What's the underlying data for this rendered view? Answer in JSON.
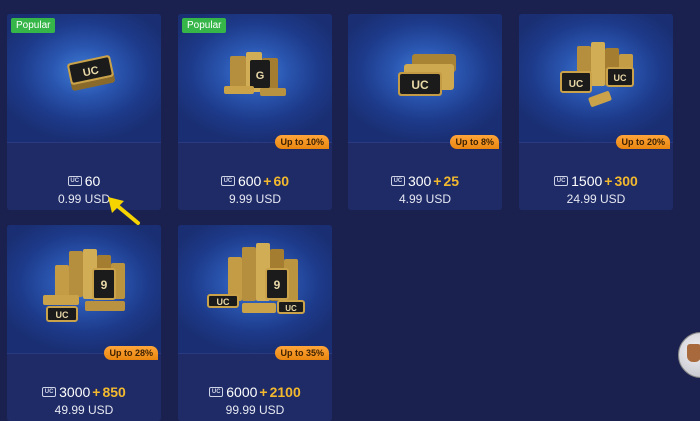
{
  "packs": [
    {
      "id": "pack-60",
      "popular": "Popular",
      "base": "60",
      "plus": "",
      "bonus": "",
      "bonus_tag": "",
      "price": "0.99 USD"
    },
    {
      "id": "pack-600",
      "popular": "Popular",
      "base": "600",
      "plus": "+",
      "bonus": "60",
      "bonus_tag": "Up to 10%",
      "price": "9.99 USD"
    },
    {
      "id": "pack-300",
      "popular": "",
      "base": "300",
      "plus": "+",
      "bonus": "25",
      "bonus_tag": "Up to 8%",
      "price": "4.99 USD"
    },
    {
      "id": "pack-1500",
      "popular": "",
      "base": "1500",
      "plus": "+",
      "bonus": "300",
      "bonus_tag": "Up to 20%",
      "price": "24.99 USD"
    },
    {
      "id": "pack-3000",
      "popular": "",
      "base": "3000",
      "plus": "+",
      "bonus": "850",
      "bonus_tag": "Up to 28%",
      "price": "49.99 USD"
    },
    {
      "id": "pack-6000",
      "popular": "",
      "base": "6000",
      "plus": "+",
      "bonus": "2100",
      "bonus_tag": "Up to 35%",
      "price": "99.99 USD"
    }
  ],
  "currency_icon": "UC",
  "annotation": {
    "arrow_color": "#f5d400"
  },
  "colors": {
    "background": "#1a214f",
    "card": "#1f2b66",
    "popular": "#36b649",
    "bonus_tag": "#f39a1f",
    "bonus_text": "#f3b92e"
  }
}
